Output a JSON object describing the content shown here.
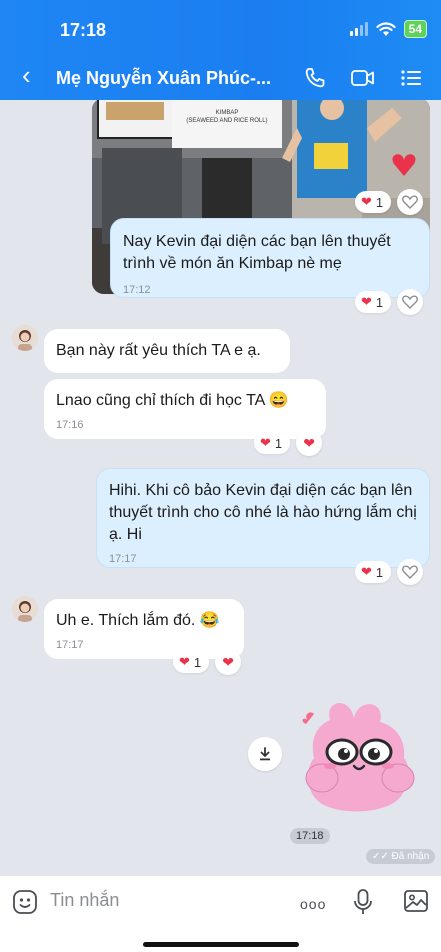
{
  "status_bar": {
    "time": "17:18",
    "battery": "54"
  },
  "header": {
    "title": "Mẹ Nguyễn Xuân Phúc-..."
  },
  "photo": {
    "sign_line1": "KIMBAP",
    "sign_line2": "(SEAWEED AND RICE ROLL)"
  },
  "messages": [
    {
      "side": "out",
      "text": "Nay Kevin đại diện các bạn lên thuyết trình về món ăn Kimbap nè mẹ",
      "time": "17:12",
      "reaction_count": "1"
    },
    {
      "side": "in",
      "text": "Bạn này rất yêu thích TA e ạ."
    },
    {
      "side": "in",
      "text": "Lnao cũng chỉ thích đi học TA 😄",
      "time": "17:16",
      "reaction_count": "1"
    },
    {
      "side": "out",
      "text": "Hihi. Khi cô bảo Kevin đại diện các bạn lên thuyết trình cho cô nhé là hào hứng lắm chị ạ. Hi",
      "time": "17:17",
      "reaction_count": "1"
    },
    {
      "side": "in",
      "text": "Uh e. Thích lắm đó. 😂",
      "time": "17:17",
      "reaction_count": "1"
    }
  ],
  "photo_reaction_count": "1",
  "sticker": {
    "time": "17:18",
    "seen_label": "Đã nhận"
  },
  "input": {
    "placeholder": "Tin nhắn",
    "more": "ooo"
  },
  "colors": {
    "header": "#1a7ef0",
    "bubble_out": "#dcefff",
    "bubble_in": "#ffffff",
    "heart": "#e8334a"
  },
  "icons": [
    "back-icon",
    "phone-icon",
    "video-call-icon",
    "menu-list-icon",
    "heart-icon",
    "like-heart-outline-icon",
    "download-icon",
    "emoji-icon",
    "microphone-icon",
    "image-icon"
  ]
}
